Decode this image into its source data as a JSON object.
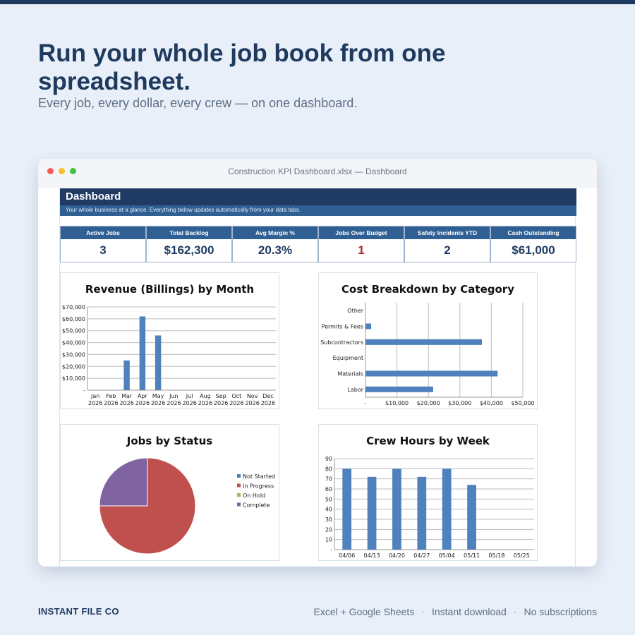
{
  "hero": {
    "headline": "Run your whole job book from one spreadsheet.",
    "subheadline": "Every job, every dollar, every crew — on one dashboard."
  },
  "window": {
    "title": "Construction KPI Dashboard.xlsx — Dashboard"
  },
  "dashboard": {
    "title": "Dashboard",
    "subtitle": "Your whole business at a glance. Everything below updates automatically from your data tabs.",
    "kpis": [
      {
        "label": "Active Jobs",
        "value": "3"
      },
      {
        "label": "Total Backlog",
        "value": "$162,300"
      },
      {
        "label": "Avg Margin %",
        "value": "20.3%"
      },
      {
        "label": "Jobs Over Budget",
        "value": "1"
      },
      {
        "label": "Safety Incidents YTD",
        "value": "2"
      },
      {
        "label": "Cash Outstanding",
        "value": "$61,000"
      }
    ]
  },
  "charts": {
    "revenue": {
      "title": "Revenue (Billings) by Month",
      "type": "bar",
      "categories": [
        "Jan 2026",
        "Feb 2026",
        "Mar 2026",
        "Apr 2026",
        "May 2026",
        "Jun 2026",
        "Jul 2026",
        "Aug 2026",
        "Sep 2026",
        "Oct 2026",
        "Nov 2026",
        "Dec 2026"
      ],
      "values": [
        0,
        0,
        25000,
        62000,
        46000,
        0,
        0,
        0,
        0,
        0,
        0,
        0
      ],
      "ylim": [
        0,
        70000
      ],
      "yticks": [
        "-",
        "$10,000",
        "$20,000",
        "$30,000",
        "$40,000",
        "$50,000",
        "$60,000",
        "$70,000"
      ],
      "color": "#4f81bd"
    },
    "cost": {
      "title": "Cost Breakdown by Category",
      "type": "bar",
      "orientation": "horizontal",
      "categories": [
        "Labor",
        "Materials",
        "Equipment",
        "Subcontractors",
        "Permits & Fees",
        "Other"
      ],
      "values": [
        21500,
        42000,
        0,
        37000,
        1800,
        0
      ],
      "xlim": [
        0,
        50000
      ],
      "xticks": [
        "-",
        "$10,000",
        "$20,000",
        "$30,000",
        "$40,000",
        "$50,000"
      ],
      "color": "#4f81bd"
    },
    "status": {
      "title": "Jobs by Status",
      "type": "pie",
      "legend": [
        "Not Started",
        "In Progress",
        "On Hold",
        "Complete"
      ],
      "values": [
        0,
        3,
        0,
        1
      ],
      "colors": [
        "#4f81bd",
        "#c0504d",
        "#9bbb59",
        "#8064a2"
      ],
      "legend_position": "right"
    },
    "crew": {
      "title": "Crew Hours by Week",
      "type": "bar",
      "categories": [
        "04/06",
        "04/13",
        "04/20",
        "04/27",
        "05/04",
        "05/11",
        "05/18",
        "05/25"
      ],
      "values": [
        80,
        72,
        80,
        72,
        80,
        64,
        0,
        0
      ],
      "ylim": [
        0,
        90
      ],
      "yticks": [
        "-",
        "10",
        "20",
        "30",
        "40",
        "50",
        "60",
        "70",
        "80",
        "90"
      ],
      "color": "#4f81bd"
    }
  },
  "footer": {
    "brand": "INSTANT FILE CO",
    "features": [
      "Excel + Google Sheets",
      "Instant download",
      "No subscriptions"
    ],
    "separator": "·"
  }
}
